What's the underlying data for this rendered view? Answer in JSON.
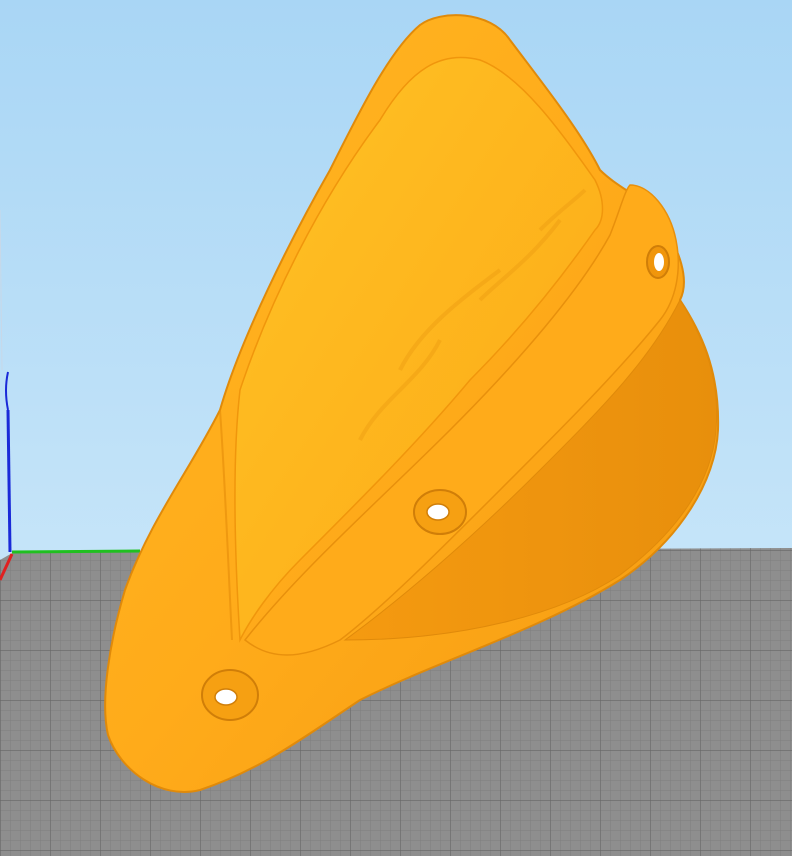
{
  "scene": {
    "background_top": "#a9d6f5",
    "background_bottom": "#d8eefc",
    "bed_color": "#8c8c8c",
    "grid_color": "#6f6f6f",
    "model_color": "#ffa51a",
    "axis_x_color": "#e02020",
    "axis_y_color": "#20c020",
    "axis_z_color": "#1a2ad8"
  }
}
